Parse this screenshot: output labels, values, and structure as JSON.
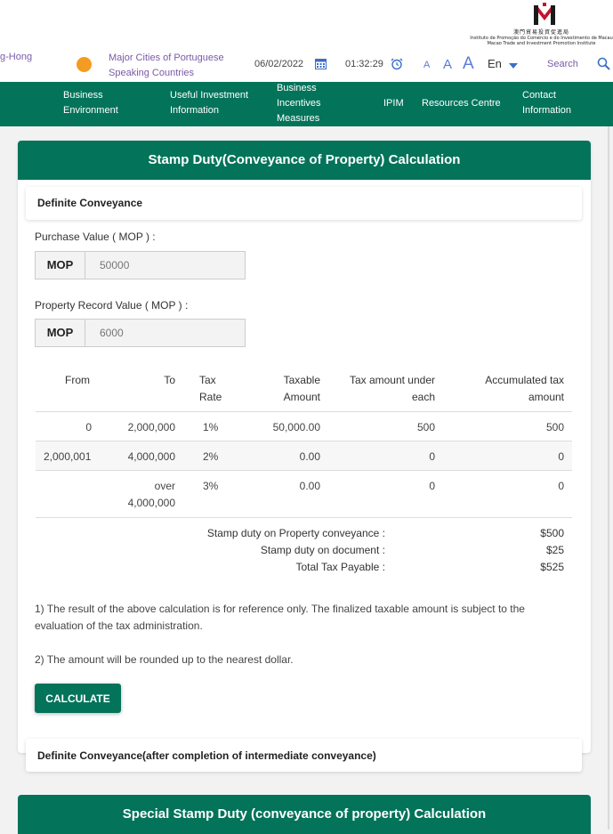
{
  "header": {
    "logo_line1": "澳門貿易投資促進局",
    "logo_line2": "Instituto de Promoção do Comércio e do Investimento de Macau",
    "logo_line3": "Macao Trade and Investment Promotion Institute",
    "cut_link": "g-Hong",
    "cities_link": "Major Cities of Portuguese Speaking Countries",
    "date": "06/02/2022",
    "time": "01:32:29",
    "font_small": "A",
    "font_medium": "A",
    "font_large": "A",
    "language": "En",
    "search_label": "Search"
  },
  "nav": {
    "items": [
      {
        "label": "Business Environment"
      },
      {
        "label": "Useful Investment Information"
      },
      {
        "label": "Business Incentives Measures"
      },
      {
        "label": "IPIM"
      },
      {
        "label": "Resources Centre"
      },
      {
        "label": "Contact Information"
      }
    ]
  },
  "calculator": {
    "title": "Stamp Duty(Conveyance of Property) Calculation",
    "subtab": "Definite Conveyance",
    "purchase_label": "Purchase Value ( MOP ) :",
    "purchase_addon": "MOP",
    "purchase_value": "50000",
    "record_label": "Property Record Value ( MOP ) :",
    "record_addon": "MOP",
    "record_value": "6000",
    "table": {
      "headers": {
        "from": "From",
        "to": "To",
        "rate": "Tax Rate",
        "taxable": "Taxable Amount",
        "tax_each": "Tax amount under each",
        "accum": "Accumulated tax amount"
      },
      "rows": [
        {
          "from": "0",
          "to": "2,000,000",
          "rate": "1%",
          "taxable": "50,000.00",
          "tax_each": "500",
          "accum": "500"
        },
        {
          "from": "2,000,001",
          "to": "4,000,000",
          "rate": "2%",
          "taxable": "0.00",
          "tax_each": "0",
          "accum": "0"
        },
        {
          "from": "",
          "to": "over 4,000,000",
          "rate": "3%",
          "taxable": "0.00",
          "tax_each": "0",
          "accum": "0"
        }
      ]
    },
    "summary": {
      "conveyance_label": "Stamp duty on Property conveyance :",
      "conveyance_value": "$500",
      "document_label": "Stamp duty on document :",
      "document_value": "$25",
      "total_label": "Total Tax Payable :",
      "total_value": "$525"
    },
    "note1": "1) The result of the above calculation is for reference only. The finalized taxable amount is subject to the evaluation of the tax administration.",
    "note2": "2) The amount will be rounded up to the nearest dollar.",
    "calculate_label": "CALCULATE",
    "subtab2": "Definite Conveyance(after completion of intermediate conveyance)"
  },
  "calculator2": {
    "title": "Special Stamp Duty (conveyance of property) Calculation"
  },
  "colors": {
    "brand_green": "#03735a",
    "accent_orange": "#f39c21",
    "link_purple": "#7b5aa8"
  }
}
